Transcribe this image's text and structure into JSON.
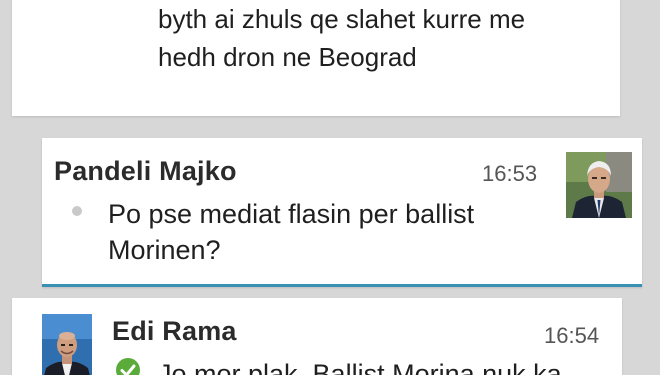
{
  "messages": [
    {
      "text": "byth ai zhuls qe slahet kurre me\nhedh dron ne Beograd"
    },
    {
      "sender": "Pandeli Majko",
      "time": "16:53",
      "text": "Po pse mediat flasin per ballist Morinen?",
      "status_icon": "unread-dot-icon",
      "avatar": "pandeli-majko-avatar"
    },
    {
      "sender": "Edi Rama",
      "time": "16:54",
      "text": "Jo mor plak, Ballist Morina nuk ka",
      "status_icon": "delivered-check-icon",
      "avatar": "edi-rama-avatar"
    }
  ],
  "colors": {
    "background": "#d7d7d7",
    "bubble": "#ffffff",
    "accent_underline": "#3a8fb5",
    "check_green": "#5bab3b"
  }
}
